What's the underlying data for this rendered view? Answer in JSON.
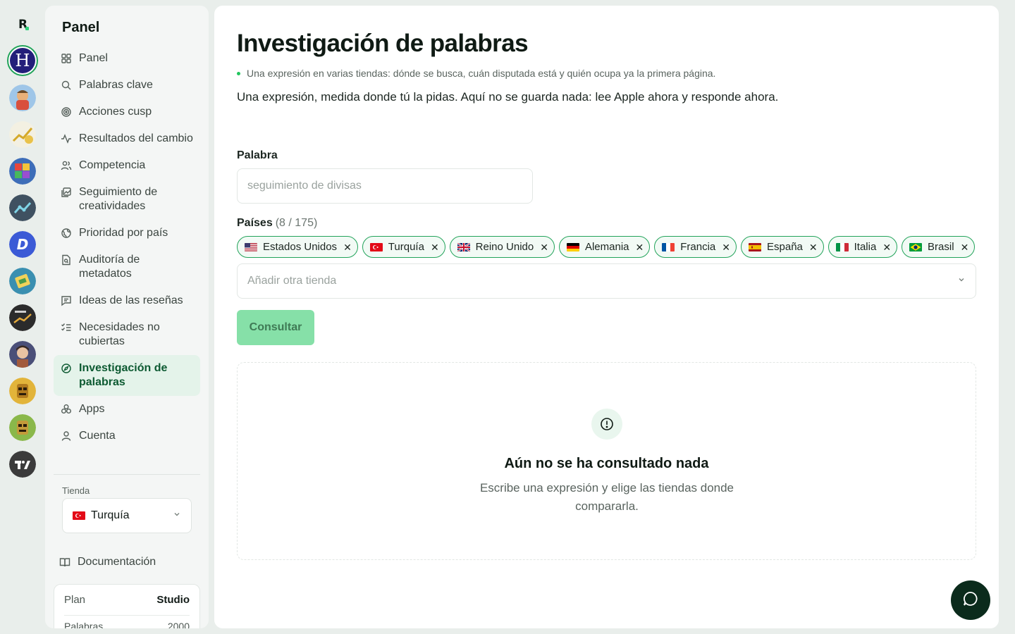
{
  "rail": {
    "logo": "R",
    "apps": [
      {
        "icon": "hotel-h-app-icon",
        "letter": "H",
        "selected": true
      },
      {
        "icon": "subway-runner-app-icon"
      },
      {
        "icon": "gold-chart-app-icon"
      },
      {
        "icon": "block-puzzle-app-icon"
      },
      {
        "icon": "line-graph-app-icon"
      },
      {
        "icon": "d-letter-app-icon"
      },
      {
        "icon": "ticket-app-icon"
      },
      {
        "icon": "investing-app-icon"
      },
      {
        "icon": "character-app-icon"
      },
      {
        "icon": "tiki-mask-app-icon"
      },
      {
        "icon": "tiki-mask-green-app-icon"
      },
      {
        "icon": "tradingview-app-icon"
      }
    ]
  },
  "sidebar": {
    "title": "Panel",
    "items": [
      {
        "label": "Panel",
        "icon": "grid-icon"
      },
      {
        "label": "Palabras clave",
        "icon": "search-icon"
      },
      {
        "label": "Acciones cusp",
        "icon": "target-icon"
      },
      {
        "label": "Resultados del cambio",
        "icon": "activity-icon"
      },
      {
        "label": "Competencia",
        "icon": "users-icon"
      },
      {
        "label": "Seguimiento de creatividades",
        "icon": "images-icon"
      },
      {
        "label": "Prioridad por país",
        "icon": "globe-icon"
      },
      {
        "label": "Auditoría de metadatos",
        "icon": "file-search-icon"
      },
      {
        "label": "Ideas de las reseñas",
        "icon": "message-icon"
      },
      {
        "label": "Necesidades no cubiertas",
        "icon": "list-check-icon"
      },
      {
        "label": "Investigación de palabras",
        "icon": "compass-icon",
        "active": true
      },
      {
        "label": "Apps",
        "icon": "apps-icon"
      },
      {
        "label": "Cuenta",
        "icon": "user-icon"
      }
    ],
    "store_label": "Tienda",
    "store_value": "Turquía",
    "docs_label": "Documentación",
    "plan_label": "Plan",
    "plan_value": "Studio",
    "plan_row2_label": "Palabras",
    "plan_row2_value": "2000"
  },
  "main": {
    "title": "Investigación de palabras",
    "subtitle": "Una expresión en varias tiendas: dónde se busca, cuán disputada está y quién ocupa ya la primera página.",
    "description": "Una expresión, medida donde tú la pidas. Aquí no se guarda nada: lee Apple ahora y responde ahora.",
    "word_label": "Palabra",
    "word_placeholder": "seguimiento de divisas",
    "word_value": "",
    "countries_label": "Países",
    "countries_count": "(8 / 175)",
    "countries": [
      {
        "name": "Estados Unidos",
        "flag": "us"
      },
      {
        "name": "Turquía",
        "flag": "tr"
      },
      {
        "name": "Reino Unido",
        "flag": "gb"
      },
      {
        "name": "Alemania",
        "flag": "de"
      },
      {
        "name": "Francia",
        "flag": "fr"
      },
      {
        "name": "España",
        "flag": "es"
      },
      {
        "name": "Italia",
        "flag": "it"
      },
      {
        "name": "Brasil",
        "flag": "br"
      }
    ],
    "add_store_placeholder": "Añadir otra tienda",
    "consult_button": "Consultar",
    "empty_title": "Aún no se ha consultado nada",
    "empty_text": "Escribe una expresión y elige las tiendas donde compararla."
  },
  "colors": {
    "accent": "#22a35a",
    "active_nav_bg": "#e4f3ea",
    "button_disabled": "#86e0a8",
    "chat_button": "#0b2b1c"
  }
}
